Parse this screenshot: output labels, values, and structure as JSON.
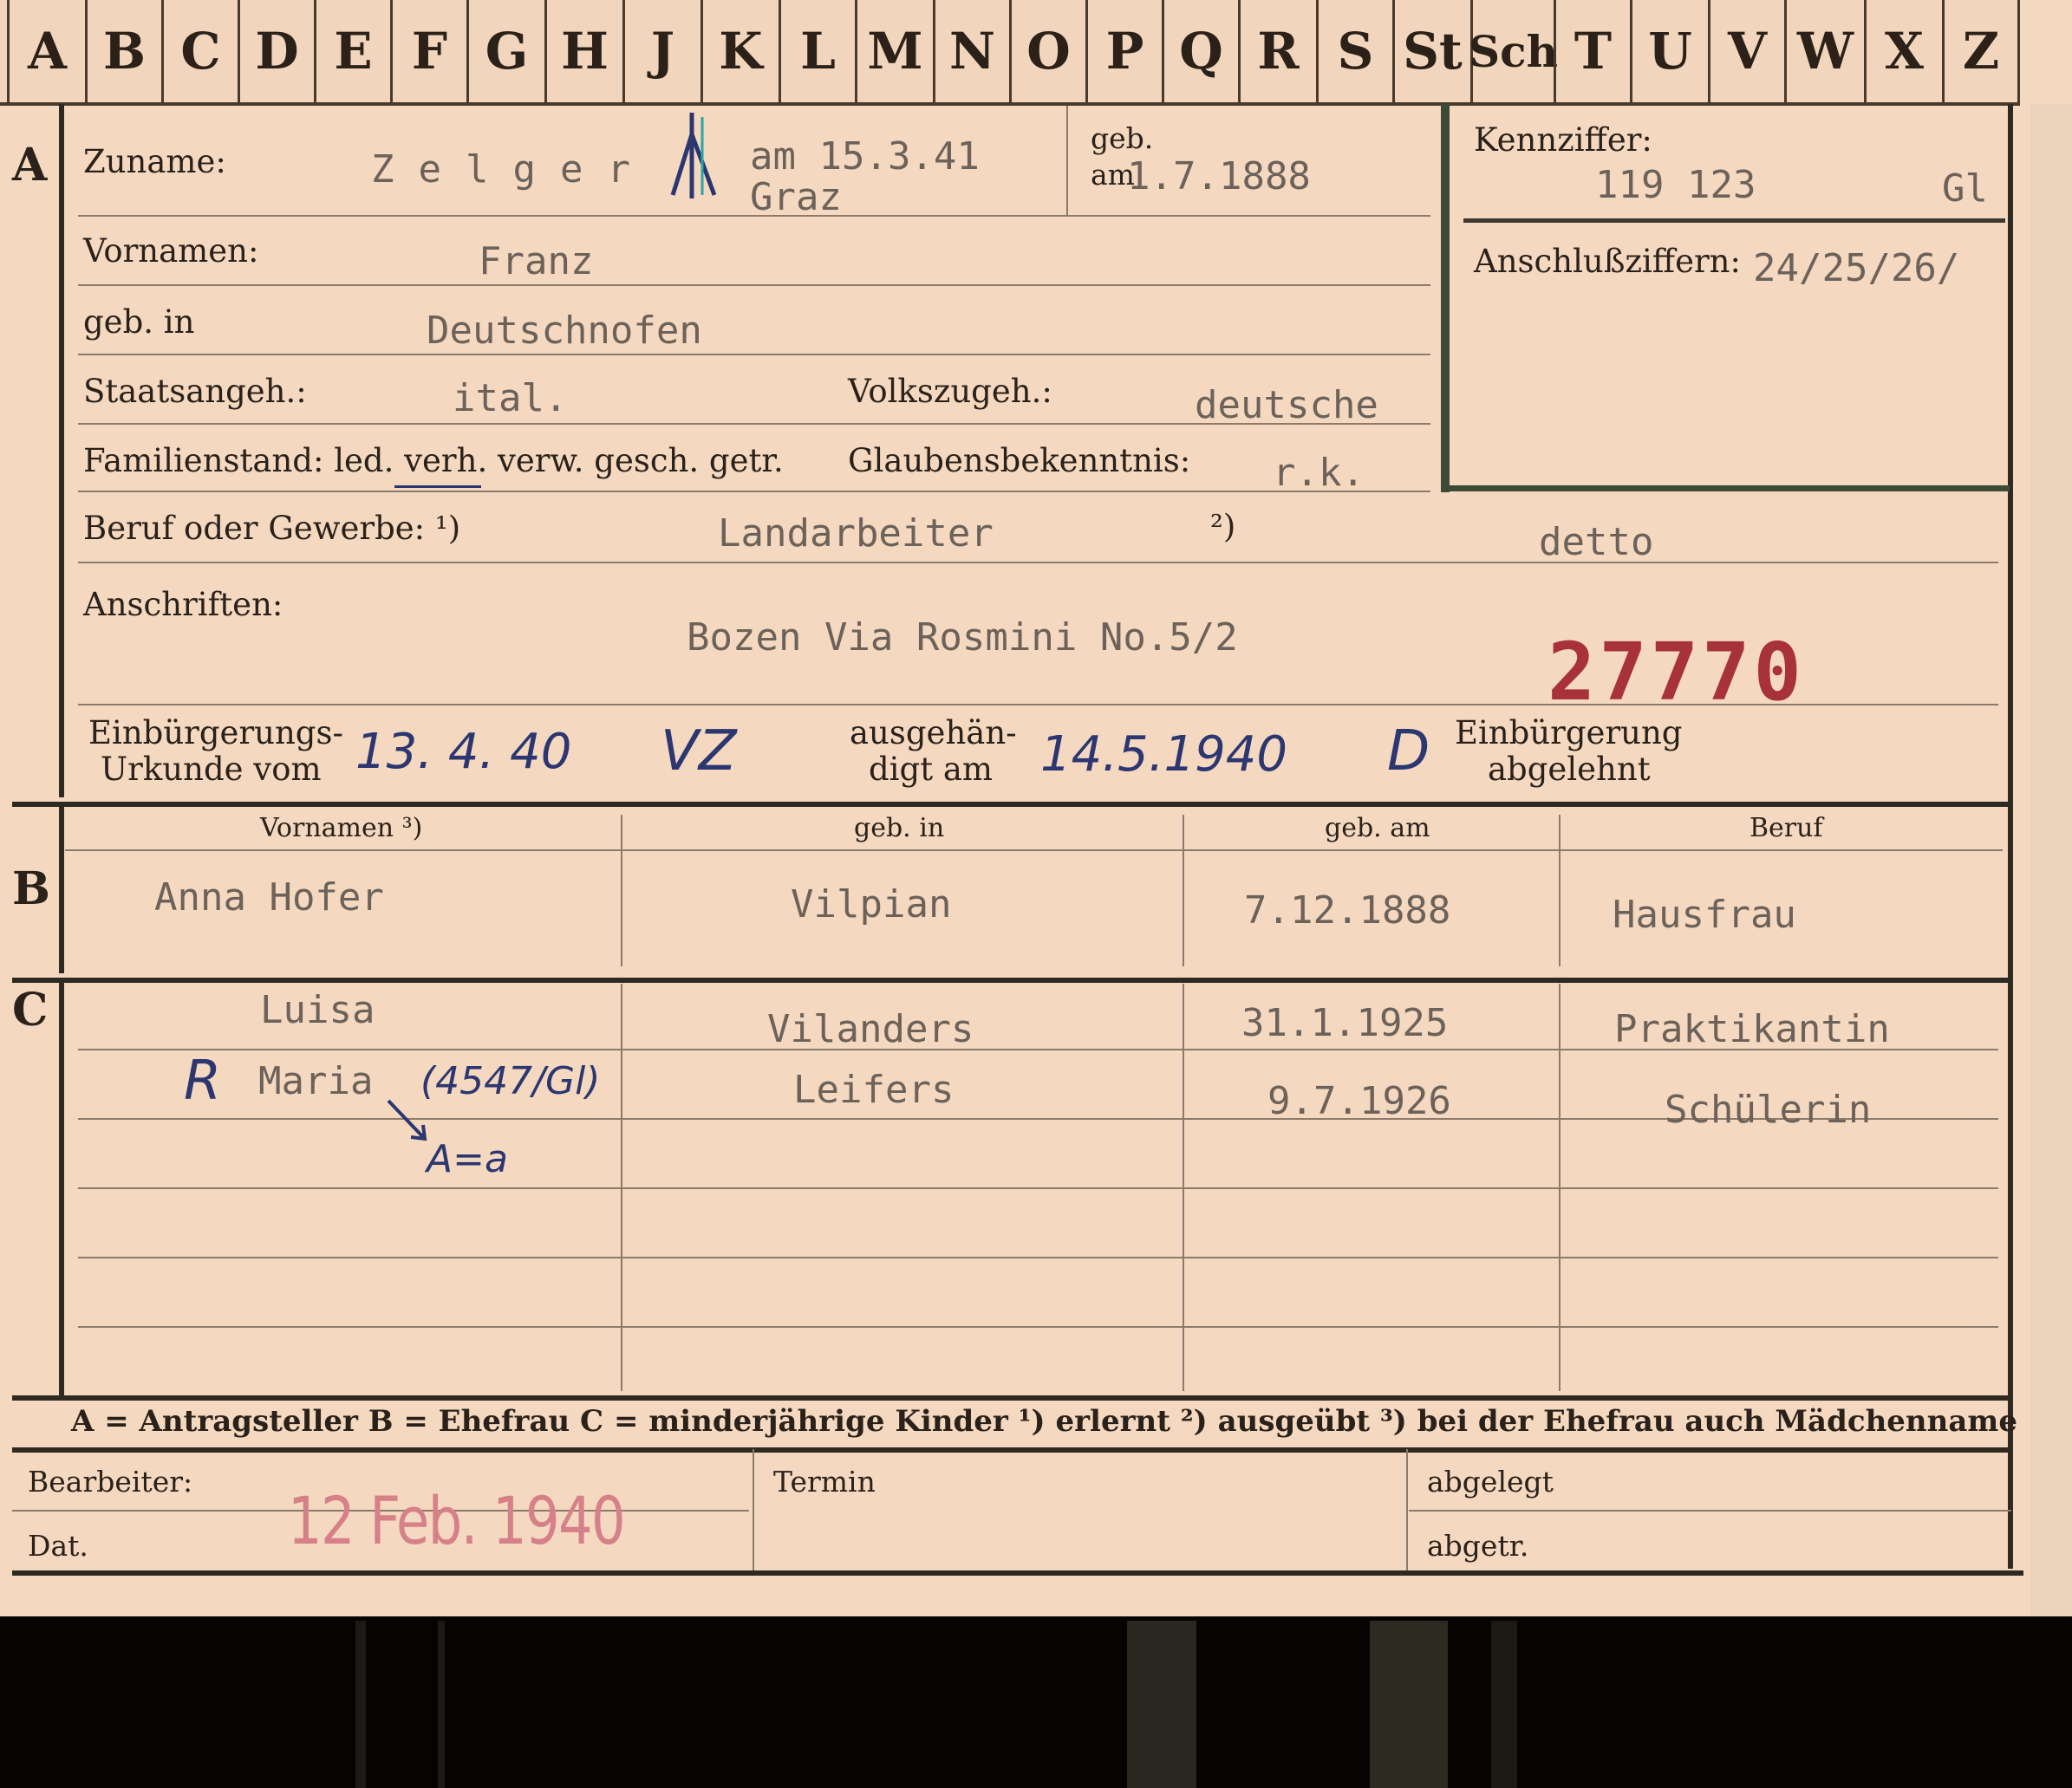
{
  "alphabet": [
    "A",
    "B",
    "C",
    "D",
    "E",
    "F",
    "G",
    "H",
    "J",
    "K",
    "L",
    "M",
    "N",
    "O",
    "P",
    "Q",
    "R",
    "S",
    "St",
    "Sch",
    "T",
    "U",
    "V",
    "W",
    "X",
    "Z"
  ],
  "sections": {
    "a": "A",
    "b": "B",
    "c": "C"
  },
  "applicant": {
    "zuname_label": "Zuname:",
    "zuname": "Zelger",
    "death_note": "am 15.3.41",
    "death_place": "Graz",
    "geb_am_label_1": "geb.",
    "geb_am_label_2": "am",
    "geb_am": "1.7.1888",
    "vornamen_label": "Vornamen:",
    "vornamen": "Franz",
    "geb_in_label": "geb. in",
    "geb_in": "Deutschnofen",
    "staatsangeh_label": "Staatsangeh.:",
    "staatsangeh": "ital.",
    "volkszugeh_label": "Volkszugeh.:",
    "volkszugeh": "deutsche",
    "familienstand_label": "Familienstand: led. verh. verw. gesch. getr.",
    "glaubens_label": "Glaubensbekenntnis:",
    "glaubens": "r.k.",
    "beruf_label": "Beruf oder Gewerbe: ¹)",
    "beruf_erlernt": "Landarbeiter",
    "beruf_sup2": "²)",
    "beruf_ausgeuebt": "detto",
    "anschriften_label": "Anschriften:",
    "anschrift": "Bozen Via Rosmini No.5/2",
    "red_number": "27770",
    "einb_label_1": "Einbürgerungs-",
    "einb_label_2": "Urkunde vom",
    "einb_date": "13. 4. 40",
    "einb_initials": "VZ",
    "ausgeh_label_1": "ausgehän-",
    "ausgeh_label_2": "digt am",
    "ausgeh_date": "14.5.1940",
    "ausgeh_initials": "D",
    "abgelehnt_1": "Einbürgerung",
    "abgelehnt_2": "abgelehnt"
  },
  "kennziffer": {
    "label": "Kennziffer:",
    "value": "119 123",
    "suffix": "Gl",
    "anschluss_label": "Anschlußziffern:",
    "anschluss_value": "24/25/26/"
  },
  "table_headers": {
    "vornamen": "Vornamen ³)",
    "geb_in": "geb. in",
    "geb_am": "geb. am",
    "beruf": "Beruf"
  },
  "spouse": {
    "name": "Anna Hofer",
    "geb_in": "Vilpian",
    "geb_am": "7.12.1888",
    "beruf": "Hausfrau"
  },
  "children": [
    {
      "name": "Luisa",
      "geb_in": "Vilanders",
      "geb_am": "31.1.1925",
      "beruf": "Praktikantin"
    },
    {
      "name": "Maria",
      "geb_in": "Leifers",
      "geb_am": "9.7.1926",
      "beruf": "Schülerin",
      "annotation": "(4547/Gl)",
      "mark": "R",
      "note": "A=a"
    }
  ],
  "legend": "A = Antragsteller   B = Ehefrau   C = minderjährige Kinder   ¹) erlernt   ²) ausgeübt   ³) bei der Ehefrau auch Mädchenname",
  "footer": {
    "bearbeiter_label": "Bearbeiter:",
    "dat_label": "Dat.",
    "dat_stamp": "12 Feb. 1940",
    "termin_label": "Termin",
    "abgelegt_label": "abgelegt",
    "abgetr_label": "abgetr."
  },
  "colors": {
    "paper": "#f4d9c0",
    "ink_blue": "#2c3670",
    "stamp_red": "#a8323a",
    "typewriter": "#6c625a"
  }
}
